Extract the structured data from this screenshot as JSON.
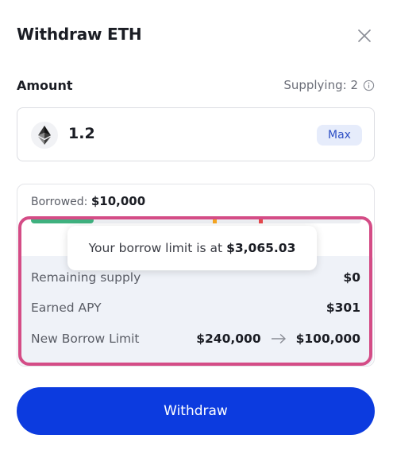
{
  "header": {
    "title": "Withdraw ETH",
    "close_icon": "close-icon"
  },
  "amount": {
    "label": "Amount",
    "supplying": "Supplying: 2",
    "info_icon": "info-icon",
    "token_icon": "ethereum-icon",
    "value": "1.2",
    "max_label": "Max"
  },
  "borrow": {
    "borrowed_label": "Borrowed:",
    "borrowed_value": "$10,000",
    "bar_fill_fraction": 0.19,
    "colors": {
      "fill": "#3fb17f",
      "warning": "#f5a623",
      "danger": "#e5484d"
    }
  },
  "tooltip": {
    "text": "Your borrow limit is at",
    "value": "$3,065.03"
  },
  "details": {
    "remaining_supply_label": "Remaining supply",
    "remaining_supply_value": "$0",
    "earned_apy_label": "Earned APY",
    "earned_apy_value": "$301",
    "new_borrow_limit_label": "New Borrow Limit",
    "borrow_limit_from": "$240,000",
    "arrow_icon": "arrow-right-icon",
    "borrow_limit_to": "$100,000"
  },
  "actions": {
    "withdraw_label": "Withdraw"
  },
  "colors": {
    "primary": "#0c3bdf",
    "highlight": "#d44c86",
    "details_bg": "#eff2f8"
  }
}
